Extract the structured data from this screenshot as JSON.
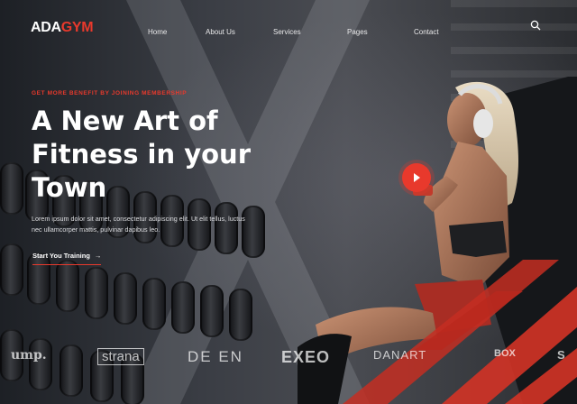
{
  "brand": {
    "logo_part1": "ADA",
    "logo_part2": "GYM"
  },
  "nav": {
    "items": [
      "Home",
      "About Us",
      "Services",
      "Pages",
      "Contact"
    ]
  },
  "hero": {
    "eyebrow": "GET MORE BENEFIT BY JOINING MEMBERSHIP",
    "title_line1": "A New Art of",
    "title_line2": "Fitness in your",
    "title_line3": "Town",
    "description_line1": "Lorem ipsum dolor sit amet, consectetur adipiscing elit. Ut elit tellus, luctus",
    "description_line2": "nec ullamcorper mattis, pulvinar dapibus leo.",
    "cta_label": "Start You Training",
    "cta_arrow": "→"
  },
  "partners": [
    "ump.",
    "strana",
    "DE EN",
    "EXEO",
    "DANART",
    "BOX",
    "S"
  ],
  "icons": {
    "search": "search-icon",
    "play": "play-icon",
    "arrow": "arrow-right-icon"
  },
  "colors": {
    "accent": "#e8392c",
    "text": "#ffffff",
    "background": "#2a2d33"
  }
}
